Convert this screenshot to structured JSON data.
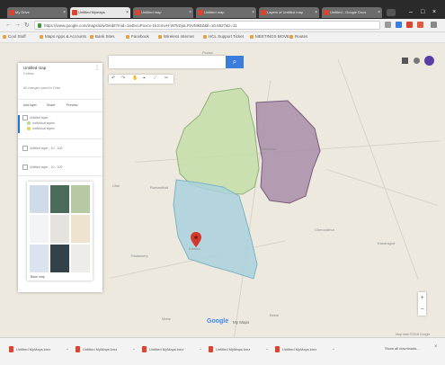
{
  "browser": {
    "tabs": [
      {
        "label": "My Drive"
      },
      {
        "label": "Untitled Mymaps"
      },
      {
        "label": "Untitled map"
      },
      {
        "label": "Untitled map"
      },
      {
        "label": "Layers of Untitled map"
      },
      {
        "label": "Untitled - Google Docs"
      }
    ],
    "active_tab": 1,
    "url": "https://www.google.com/maps/d/u/0/edit?mid=1a4bcuPuxcx-1kJcmvH-W7kDjuLFbVMk5Z&ll=10.6527&z=11",
    "window_controls": [
      "–",
      "□",
      "×"
    ],
    "bookmarks": [
      "Cool Stuff",
      "Maps Apps & Accounts",
      "Bank Sites",
      "Facebook",
      "Wireless Internet",
      "HCL Support Ticket",
      "MEETINGS MOVE",
      "Routes"
    ]
  },
  "panel": {
    "title": "Untitled map",
    "subtitle": "0 views",
    "last_change": "All changes saved in Drive",
    "actions": [
      "Add layer",
      "Share",
      "Preview"
    ],
    "layers": [
      {
        "label": "Untitled layer"
      },
      {
        "label": "Untitled layer - 10 - 100"
      },
      {
        "label": "Untitled layer - 10 - 100"
      }
    ],
    "styles": [
      {
        "label": "Individual styles",
        "color": "#b8dc9a"
      },
      {
        "label": "Individual styles",
        "color": "#e6d34a"
      }
    ],
    "base_map_label": "Base map",
    "base_maps": [
      {
        "name": "Map",
        "color": "#cfdbe8"
      },
      {
        "name": "Satellite",
        "color": "#4c6a5a"
      },
      {
        "name": "Terrain",
        "color": "#b6c9a2"
      },
      {
        "name": "Light political",
        "color": "#f3f4f6"
      },
      {
        "name": "Mono city",
        "color": "#e6e3de"
      },
      {
        "name": "Simple atlas",
        "color": "#ede3cf"
      },
      {
        "name": "Light landmass",
        "color": "#dbe4ee"
      },
      {
        "name": "Dark landmass",
        "color": "#33414a"
      },
      {
        "name": "Whitewater",
        "color": "#eeece8"
      }
    ]
  },
  "search": {
    "placeholder": ""
  },
  "toolbar": {
    "tools": [
      "↶",
      "↷",
      "✋",
      "⌖",
      "⟋",
      "✂"
    ]
  },
  "map": {
    "shapes": [
      {
        "name": "region-green",
        "fill": "#c4dea9",
        "stroke": "#8fb27a"
      },
      {
        "name": "region-purple",
        "fill": "#a88ea9",
        "stroke": "#7a5a7c"
      },
      {
        "name": "region-blue",
        "fill": "#a9d1dd",
        "stroke": "#7fb3c4"
      }
    ],
    "marker_color": "#d1392f",
    "labels": [
      "Puraia",
      "Ramanthali",
      "Kannur",
      "Nileshwar",
      "Cheruvathur",
      "Thalassery",
      "Mahe",
      "Kasaragod",
      "Bekal",
      "Ullal"
    ],
    "zoom_in": "+",
    "zoom_out": "−",
    "logo": "Google",
    "logo_suffix": "My Maps",
    "attribution": "Map data ©2018 Google"
  },
  "downloads": {
    "items": [
      {
        "name": "Untitled MyMaps.kmz"
      },
      {
        "name": "Untitled MyMaps.kmz"
      },
      {
        "name": "Untitled MyMaps.kmz"
      },
      {
        "name": "Untitled MyMaps.kmz"
      },
      {
        "name": "Untitled MyMaps.kmz"
      }
    ],
    "show_all": "Show all downloads...",
    "close": "×"
  }
}
